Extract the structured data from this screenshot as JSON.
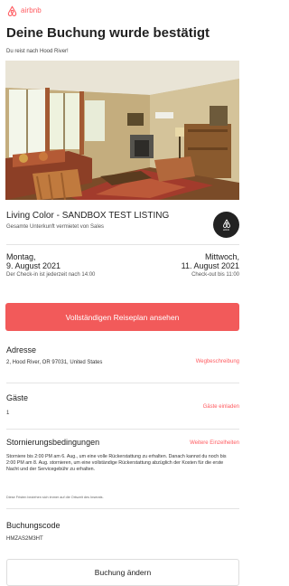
{
  "brand": {
    "name": "airbnb",
    "icon": "airbnb-logo-icon",
    "color": "#ff5a5f"
  },
  "header": {
    "title": "Deine Buchung wurde bestätigt",
    "subtitle": "Du reist nach Hood River!"
  },
  "listing": {
    "title": "Living Color - SANDBOX TEST LISTING",
    "subtitle": "Gesamte Unterkunft vermietet von Sales",
    "photo": "living-room-photo",
    "host_avatar_icon": "airbnb-logo-icon",
    "host_avatar_text": "airbnb"
  },
  "checkin": {
    "day": "Montag,",
    "date": "9. August 2021",
    "note": "Der Check-in ist jederzeit nach 14:00"
  },
  "checkout": {
    "day": "Mittwoch,",
    "date": "11. August 2021",
    "note": "Check-out bis 11:00"
  },
  "actions": {
    "itinerary_label": "Vollständigen Reiseplan ansehen",
    "change_booking_label": "Buchung ändern",
    "accent_color": "#f25a5a"
  },
  "address": {
    "label": "Adresse",
    "value": "2, Hood River, OR 97031, United States",
    "link": "Wegbeschreibung"
  },
  "guests": {
    "label": "Gäste",
    "value": "1",
    "link": "Gäste einladen"
  },
  "cancellation": {
    "label": "Stornierungsbedingungen",
    "link": "Weitere Einzelheiten",
    "text": "Storniere bis 2:00 PM am 6. Aug., um eine volle Rückerstattung zu erhalten. Danach kannst du noch bis 2:00 PM am 8. Aug. stornieren, um eine vollständige Rückerstattung abzüglich der Kosten für die erste Nacht und der Servicegebühr zu erhalten.",
    "note": "Diese Fristen beziehen sich immer auf die Ortszeit des Inserats."
  },
  "booking_code": {
    "label": "Buchungscode",
    "value": "HMZAS2M3HT"
  }
}
